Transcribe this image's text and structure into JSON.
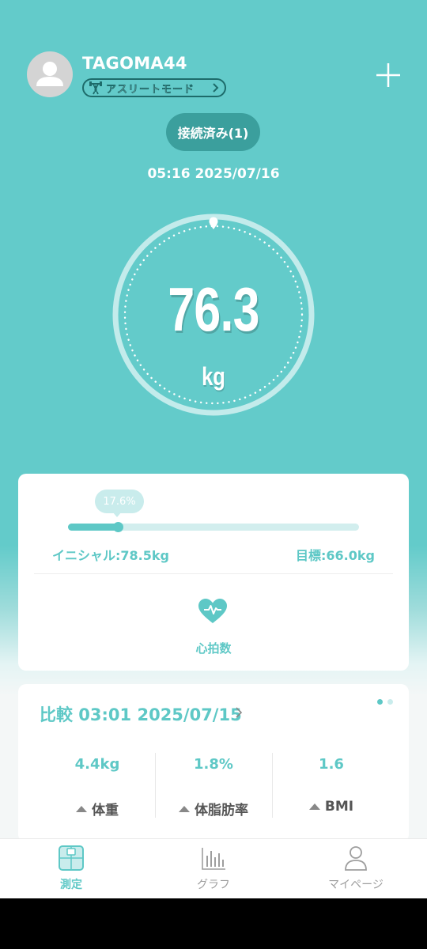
{
  "header": {
    "username": "TAGOMA44",
    "mode_label": "アスリートモード",
    "connection_status": "接続済み(1)",
    "datetime": "05:16 2025/07/16"
  },
  "measurement": {
    "weight": "76.3",
    "unit": "kg"
  },
  "progress": {
    "percent_label": "17.6%",
    "fraction": 0.176,
    "initial_label": "イニシャル:78.5kg",
    "goal_label": "目標:66.0kg"
  },
  "heart_rate": {
    "label": "心拍数"
  },
  "comparison": {
    "title": "比較 03:01 2025/07/15",
    "page_dots": 2,
    "metrics": [
      {
        "value": "4.4kg",
        "label": "体重",
        "trend": "down"
      },
      {
        "value": "1.8%",
        "label": "体脂肪率",
        "trend": "down"
      },
      {
        "value": "1.6",
        "label": "BMI",
        "trend": "down"
      }
    ]
  },
  "nav": {
    "items": [
      {
        "label": "測定",
        "icon": "scale-icon",
        "active": true
      },
      {
        "label": "グラフ",
        "icon": "bar-chart-icon",
        "active": false
      },
      {
        "label": "マイページ",
        "icon": "person-icon",
        "active": false
      }
    ]
  },
  "colors": {
    "accent": "#5ec8c6",
    "header_bg": "#63cbca",
    "connected_pill": "#3b9f9d",
    "inactive": "#9e9e9e"
  }
}
